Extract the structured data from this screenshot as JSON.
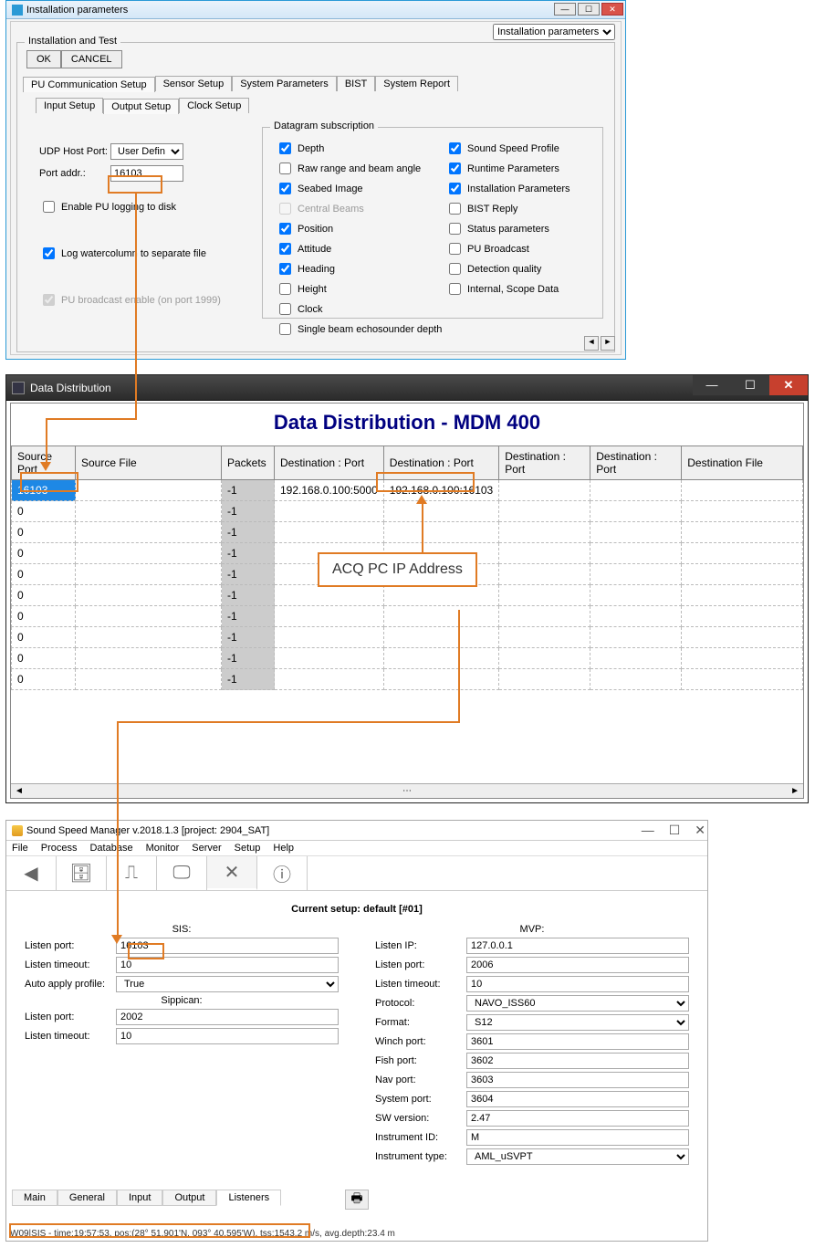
{
  "win1": {
    "title": "Installation parameters",
    "topCombo": "Installation parameters",
    "fieldsetLegend": "Installation and Test",
    "ok": "OK",
    "cancel": "CANCEL",
    "mainTabs": [
      "PU Communication Setup",
      "Sensor Setup",
      "System Parameters",
      "BIST",
      "System Report"
    ],
    "subTabs": [
      "Input Setup",
      "Output Setup",
      "Clock Setup"
    ],
    "udpHostPortLabel": "UDP Host Port:",
    "udpHostPortValue": "User Defined",
    "portAddrLabel": "Port addr.:",
    "portAddrValue": "16103",
    "enablePU": "Enable PU logging to disk",
    "logWC": "Log watercolumn to separate file",
    "puBroadcast": "PU broadcast enable (on port 1999)",
    "dgLegend": "Datagram subscription",
    "dgLeft": [
      {
        "label": "Depth",
        "checked": true,
        "disabled": false
      },
      {
        "label": "Raw range and beam angle",
        "checked": false,
        "disabled": false
      },
      {
        "label": "Seabed Image",
        "checked": true,
        "disabled": false
      },
      {
        "label": "Central Beams",
        "checked": false,
        "disabled": true
      },
      {
        "label": "Position",
        "checked": true,
        "disabled": false
      },
      {
        "label": "Attitude",
        "checked": true,
        "disabled": false
      },
      {
        "label": "Heading",
        "checked": true,
        "disabled": false
      },
      {
        "label": "Height",
        "checked": false,
        "disabled": false
      },
      {
        "label": "Clock",
        "checked": false,
        "disabled": false
      },
      {
        "label": "Single beam echosounder depth",
        "checked": false,
        "disabled": false
      }
    ],
    "dgRight": [
      {
        "label": "Sound Speed Profile",
        "checked": true
      },
      {
        "label": "Runtime Parameters",
        "checked": true
      },
      {
        "label": "Installation Parameters",
        "checked": true
      },
      {
        "label": "BIST Reply",
        "checked": false
      },
      {
        "label": "Status parameters",
        "checked": false
      },
      {
        "label": "PU Broadcast",
        "checked": false
      },
      {
        "label": "Detection quality",
        "checked": false
      },
      {
        "label": "Internal, Scope Data",
        "checked": false
      }
    ]
  },
  "win2": {
    "title": "Data Distribution",
    "heading": "Data Distribution  -  MDM 400",
    "headers": [
      "Source Port",
      "Source File",
      "Packets",
      "Destination : Port",
      "Destination : Port",
      "Destination : Port",
      "Destination : Port",
      "Destination File"
    ],
    "rows": [
      {
        "src": "16103",
        "file": "",
        "pkt": "-1",
        "d1": "192.168.0.100:5000",
        "d2": "192.168.0.100:16103",
        "d3": "",
        "d4": "",
        "df": ""
      },
      {
        "src": "0",
        "file": "",
        "pkt": "-1",
        "d1": "",
        "d2": "",
        "d3": "",
        "d4": "",
        "df": ""
      },
      {
        "src": "0",
        "file": "",
        "pkt": "-1",
        "d1": "",
        "d2": "",
        "d3": "",
        "d4": "",
        "df": ""
      },
      {
        "src": "0",
        "file": "",
        "pkt": "-1",
        "d1": "",
        "d2": "",
        "d3": "",
        "d4": "",
        "df": ""
      },
      {
        "src": "0",
        "file": "",
        "pkt": "-1",
        "d1": "",
        "d2": "",
        "d3": "",
        "d4": "",
        "df": ""
      },
      {
        "src": "0",
        "file": "",
        "pkt": "-1",
        "d1": "",
        "d2": "",
        "d3": "",
        "d4": "",
        "df": ""
      },
      {
        "src": "0",
        "file": "",
        "pkt": "-1",
        "d1": "",
        "d2": "",
        "d3": "",
        "d4": "",
        "df": ""
      },
      {
        "src": "0",
        "file": "",
        "pkt": "-1",
        "d1": "",
        "d2": "",
        "d3": "",
        "d4": "",
        "df": ""
      },
      {
        "src": "0",
        "file": "",
        "pkt": "-1",
        "d1": "",
        "d2": "",
        "d3": "",
        "d4": "",
        "df": ""
      },
      {
        "src": "0",
        "file": "",
        "pkt": "-1",
        "d1": "",
        "d2": "",
        "d3": "",
        "d4": "",
        "df": ""
      }
    ]
  },
  "win3": {
    "title": "Sound Speed Manager v.2018.1.3 [project: 2904_SAT]",
    "menus": [
      "File",
      "Process",
      "Database",
      "Monitor",
      "Server",
      "Setup",
      "Help"
    ],
    "setupTitle": "Current setup: default [#01]",
    "sisHeader": "SIS:",
    "sippicanHeader": "Sippican:",
    "mvpHeader": "MVP:",
    "sis": {
      "listenPortLabel": "Listen port:",
      "listenPort": "16103",
      "listenTimeoutLabel": "Listen timeout:",
      "listenTimeout": "10",
      "autoApplyLabel": "Auto apply profile:",
      "autoApply": "True"
    },
    "sippican": {
      "listenPortLabel": "Listen port:",
      "listenPort": "2002",
      "listenTimeoutLabel": "Listen timeout:",
      "listenTimeout": "10"
    },
    "mvp": {
      "listenIPLabel": "Listen IP:",
      "listenIP": "127.0.0.1",
      "listenPortLabel": "Listen port:",
      "listenPort": "2006",
      "listenTimeoutLabel": "Listen timeout:",
      "listenTimeout": "10",
      "protocolLabel": "Protocol:",
      "protocol": "NAVO_ISS60",
      "formatLabel": "Format:",
      "format": "S12",
      "winchLabel": "Winch port:",
      "winch": "3601",
      "fishLabel": "Fish port:",
      "fish": "3602",
      "navLabel": "Nav port:",
      "nav": "3603",
      "systemLabel": "System port:",
      "system": "3604",
      "swLabel": "SW version:",
      "sw": "2.47",
      "instrIdLabel": "Instrument ID:",
      "instrId": "M",
      "instrTypeLabel": "Instrument type:",
      "instrType": "AML_uSVPT"
    },
    "bottomTabs": [
      "Main",
      "General",
      "Input",
      "Output",
      "Listeners"
    ],
    "status": "W09|SIS  -  time:19:57:53, pos:(28° 51.901'N, 093° 40.595'W),  tss:1543.2 m/s,  avg.depth:23.4 m"
  },
  "annot": {
    "label": "ACQ PC IP Address"
  }
}
